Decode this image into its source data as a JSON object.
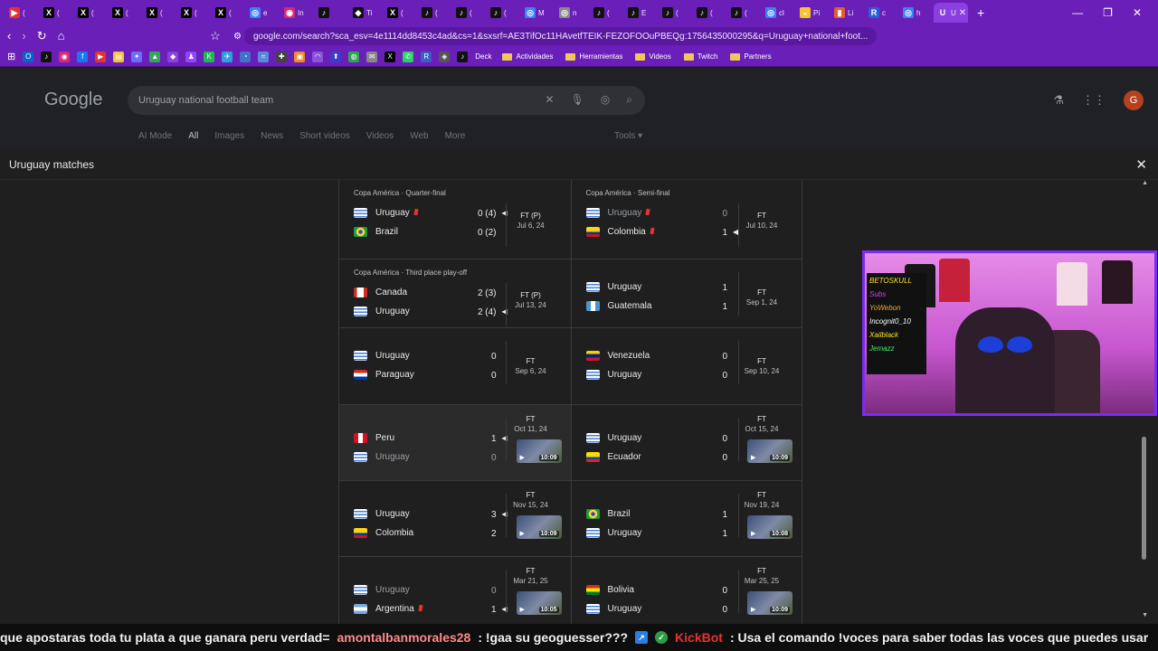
{
  "browser": {
    "tabs": [
      {
        "icon": "youtube-icon",
        "color": "#e3342f",
        "label": "(",
        "glyph": "▶"
      },
      {
        "icon": "x-icon",
        "color": "#000000",
        "label": "(",
        "glyph": "X"
      },
      {
        "icon": "x-icon",
        "color": "#000000",
        "label": "(",
        "glyph": "X"
      },
      {
        "icon": "x-icon",
        "color": "#000000",
        "label": "(",
        "glyph": "X"
      },
      {
        "icon": "x-icon",
        "color": "#000000",
        "label": "(",
        "glyph": "X"
      },
      {
        "icon": "x-icon",
        "color": "#000000",
        "label": "(",
        "glyph": "X"
      },
      {
        "icon": "x-icon",
        "color": "#000000",
        "label": "(",
        "glyph": "X"
      },
      {
        "icon": "globe-icon",
        "color": "#3b82f6",
        "label": "e",
        "glyph": "◎"
      },
      {
        "icon": "instagram-icon",
        "color": "#d62976",
        "label": "In",
        "glyph": "◉"
      },
      {
        "icon": "tiktok-icon",
        "color": "#111111",
        "label": "",
        "glyph": "♪"
      },
      {
        "icon": "tiktok-icon",
        "color": "#111111",
        "label": "Ti",
        "glyph": "◆"
      },
      {
        "icon": "x-icon",
        "color": "#000000",
        "label": "(",
        "glyph": "X"
      },
      {
        "icon": "tiktok-icon",
        "color": "#111111",
        "label": "(",
        "glyph": "♪"
      },
      {
        "icon": "tiktok-icon",
        "color": "#111111",
        "label": "(",
        "glyph": "♪"
      },
      {
        "icon": "tiktok-icon",
        "color": "#111111",
        "label": "(",
        "glyph": "♪"
      },
      {
        "icon": "globe-icon",
        "color": "#3b82f6",
        "label": "M",
        "glyph": "◎"
      },
      {
        "icon": "globe-icon",
        "color": "#888888",
        "label": "n",
        "glyph": "◎"
      },
      {
        "icon": "tiktok-icon",
        "color": "#111111",
        "label": "(",
        "glyph": "♪"
      },
      {
        "icon": "tiktok-icon",
        "color": "#111111",
        "label": "E",
        "glyph": "♪"
      },
      {
        "icon": "tiktok-icon",
        "color": "#111111",
        "label": "(",
        "glyph": "♪"
      },
      {
        "icon": "tiktok-icon",
        "color": "#111111",
        "label": "(",
        "glyph": "♪"
      },
      {
        "icon": "tiktok-icon",
        "color": "#111111",
        "label": "(",
        "glyph": "♪"
      },
      {
        "icon": "globe-icon",
        "color": "#3b82f6",
        "label": "cl",
        "glyph": "◎"
      },
      {
        "icon": "pi-icon",
        "color": "#f4c430",
        "label": "Pi",
        "glyph": "◒"
      },
      {
        "icon": "bookmark-icon",
        "color": "#e85c2c",
        "label": "Li",
        "glyph": "▮"
      },
      {
        "icon": "reddit-icon",
        "color": "#2b5dd8",
        "label": "c",
        "glyph": "R"
      },
      {
        "icon": "globe-icon",
        "color": "#3b82f6",
        "label": "h",
        "glyph": "◎"
      },
      {
        "icon": "google-icon",
        "color": "#8b3fe0",
        "label": "U",
        "glyph": "U",
        "active": true
      }
    ],
    "url": "google.com/search?sca_esv=4e1114dd8453c4ad&cs=1&sxsrf=AE3TifOc11HAvetfTEIK-FEZOFOOuPBEQg:1756435000295&q=Uruguay+national+foot...",
    "bookmarks": [
      {
        "icon": "outlook-icon",
        "color": "#0a64c8",
        "glyph": "O"
      },
      {
        "icon": "tiktok-icon",
        "color": "#111111",
        "glyph": "♪"
      },
      {
        "icon": "instagram-icon",
        "color": "#d62976",
        "glyph": "◉"
      },
      {
        "icon": "facebook-icon",
        "color": "#1877f2",
        "glyph": "f"
      },
      {
        "icon": "youtube-icon",
        "color": "#e3342f",
        "glyph": "▶"
      },
      {
        "icon": "sheets-icon",
        "color": "#f4c430",
        "glyph": "▤"
      },
      {
        "icon": "tool-icon",
        "color": "#6c6cff",
        "glyph": "✦"
      },
      {
        "icon": "drive-icon",
        "color": "#34a853",
        "glyph": "▲"
      },
      {
        "icon": "pin-icon",
        "color": "#8b3fe0",
        "glyph": "◆"
      },
      {
        "icon": "twitch-icon",
        "color": "#9146ff",
        "glyph": "♟"
      },
      {
        "icon": "kick-icon",
        "color": "#1db954",
        "glyph": "K"
      },
      {
        "icon": "telegram-icon",
        "color": "#2aa1da",
        "glyph": "✈"
      },
      {
        "icon": "stat-icon",
        "color": "#3f73c8",
        "glyph": "◔"
      },
      {
        "icon": "wave-icon",
        "color": "#5a8ad8",
        "glyph": "≈"
      },
      {
        "icon": "game-icon",
        "color": "#444444",
        "glyph": "✚"
      },
      {
        "icon": "orange-icon",
        "color": "#f08a24",
        "glyph": "▣"
      },
      {
        "icon": "arc-icon",
        "color": "#8a55d8",
        "glyph": "◠"
      },
      {
        "icon": "upload-icon",
        "color": "#3c3cc8",
        "glyph": "⬆"
      },
      {
        "icon": "green-icon",
        "color": "#2ea44f",
        "glyph": "◍"
      },
      {
        "icon": "mail-icon",
        "color": "#888888",
        "glyph": "✉"
      },
      {
        "icon": "x-icon",
        "color": "#000000",
        "glyph": "X"
      },
      {
        "icon": "whatsapp-icon",
        "color": "#25d366",
        "glyph": "✆"
      },
      {
        "icon": "r-icon",
        "color": "#3c5cc8",
        "glyph": "R"
      },
      {
        "icon": "diamond-icon",
        "color": "#555555",
        "glyph": "◈"
      },
      {
        "icon": "deck-icon",
        "color": "#111111",
        "glyph": "♪"
      }
    ],
    "bookmark_deck": "Deck",
    "folders": [
      "Actividades",
      "Herramientas",
      "Videos",
      "Twitch",
      "Partners"
    ]
  },
  "google": {
    "logo": "Google",
    "query": "Uruguay national football team",
    "tabs": [
      "AI Mode",
      "All",
      "Images",
      "News",
      "Short videos",
      "Videos",
      "Web",
      "More"
    ],
    "active_tab": "All",
    "tools": "Tools",
    "avatar_letter": "G"
  },
  "panel": {
    "title": "Uruguay matches",
    "rows": [
      [
        {
          "comp": "Copa América · Quarter-final",
          "t1": {
            "name": "Uruguay",
            "flag": "uru",
            "score": "0 (4)",
            "red": true,
            "win": false
          },
          "t2": {
            "name": "Brazil",
            "flag": "bra",
            "score": "0 (2)",
            "red": false,
            "win": false
          },
          "status": "FT (P)",
          "date": "Jul 6, 24",
          "video": false,
          "dim": 0,
          "winner": 1
        },
        {
          "comp": "Copa América · Semi-final",
          "t1": {
            "name": "Uruguay",
            "flag": "uru",
            "score": "0",
            "red": true
          },
          "t2": {
            "name": "Colombia",
            "flag": "col",
            "score": "1",
            "red": true
          },
          "status": "FT",
          "date": "Jul 10, 24",
          "video": false,
          "dim": 1,
          "winner": 2
        }
      ],
      [
        {
          "comp": "Copa América · Third place play-off",
          "t1": {
            "name": "Canada",
            "flag": "can",
            "score": "2 (3)"
          },
          "t2": {
            "name": "Uruguay",
            "flag": "uru",
            "score": "2 (4)"
          },
          "status": "FT (P)",
          "date": "Jul 13, 24",
          "video": false,
          "dim": 0,
          "winner": 2
        },
        {
          "comp": "",
          "t1": {
            "name": "Uruguay",
            "flag": "uru",
            "score": "1"
          },
          "t2": {
            "name": "Guatemala",
            "flag": "gua",
            "score": "1"
          },
          "status": "FT",
          "date": "Sep 1, 24",
          "video": false,
          "dim": 0,
          "winner": 0
        }
      ],
      [
        {
          "comp": "",
          "t1": {
            "name": "Uruguay",
            "flag": "uru",
            "score": "0"
          },
          "t2": {
            "name": "Paraguay",
            "flag": "par",
            "score": "0"
          },
          "status": "FT",
          "date": "Sep 6, 24",
          "video": false,
          "dim": 0,
          "winner": 0
        },
        {
          "comp": "",
          "t1": {
            "name": "Venezuela",
            "flag": "ven",
            "score": "0"
          },
          "t2": {
            "name": "Uruguay",
            "flag": "uru",
            "score": "0"
          },
          "status": "FT",
          "date": "Sep 10, 24",
          "video": false,
          "dim": 0,
          "winner": 0
        }
      ],
      [
        {
          "comp": "",
          "t1": {
            "name": "Peru",
            "flag": "per",
            "score": "1"
          },
          "t2": {
            "name": "Uruguay",
            "flag": "uru",
            "score": "0"
          },
          "status": "FT",
          "date": "Oct 11, 24",
          "video": true,
          "duration": "10:09",
          "dim": 2,
          "winner": 1,
          "hl": true
        },
        {
          "comp": "",
          "t1": {
            "name": "Uruguay",
            "flag": "uru",
            "score": "0"
          },
          "t2": {
            "name": "Ecuador",
            "flag": "ecu",
            "score": "0"
          },
          "status": "FT",
          "date": "Oct 15, 24",
          "video": true,
          "duration": "10:09",
          "dim": 0,
          "winner": 0
        }
      ],
      [
        {
          "comp": "",
          "t1": {
            "name": "Uruguay",
            "flag": "uru",
            "score": "3"
          },
          "t2": {
            "name": "Colombia",
            "flag": "col",
            "score": "2"
          },
          "status": "FT",
          "date": "Nov 15, 24",
          "video": true,
          "duration": "10:09",
          "dim": 0,
          "winner": 1
        },
        {
          "comp": "",
          "t1": {
            "name": "Brazil",
            "flag": "bra",
            "score": "1"
          },
          "t2": {
            "name": "Uruguay",
            "flag": "uru",
            "score": "1"
          },
          "status": "FT",
          "date": "Nov 19, 24",
          "video": true,
          "duration": "10:08",
          "dim": 0,
          "winner": 0
        }
      ],
      [
        {
          "comp": "",
          "t1": {
            "name": "Uruguay",
            "flag": "uru",
            "score": "0"
          },
          "t2": {
            "name": "Argentina",
            "flag": "arg",
            "score": "1",
            "red": true
          },
          "status": "FT",
          "date": "Mar 21, 25",
          "video": true,
          "duration": "10:05",
          "dim": 1,
          "winner": 2
        },
        {
          "comp": "",
          "t1": {
            "name": "Bolivia",
            "flag": "bol",
            "score": "0"
          },
          "t2": {
            "name": "Uruguay",
            "flag": "uru",
            "score": "0"
          },
          "status": "FT",
          "date": "Mar 25, 25",
          "video": true,
          "duration": "10:09",
          "dim": 0,
          "winner": 0
        }
      ]
    ]
  },
  "webcam": {
    "board_lines": [
      "BETOSKULL",
      "Subs",
      "YoWebon",
      "Incognit0_10",
      "Xailblack",
      "Jemazz"
    ]
  },
  "ticker": {
    "part1": "que apostaras toda tu plata a que ganara peru verdad=",
    "user": "amontalbanmorales28",
    "msg": ": !gaa su geoguesser???",
    "bot": "KickBot",
    "bot_msg": ": Usa el comando !voces para saber todas las voces que puedes usar"
  }
}
